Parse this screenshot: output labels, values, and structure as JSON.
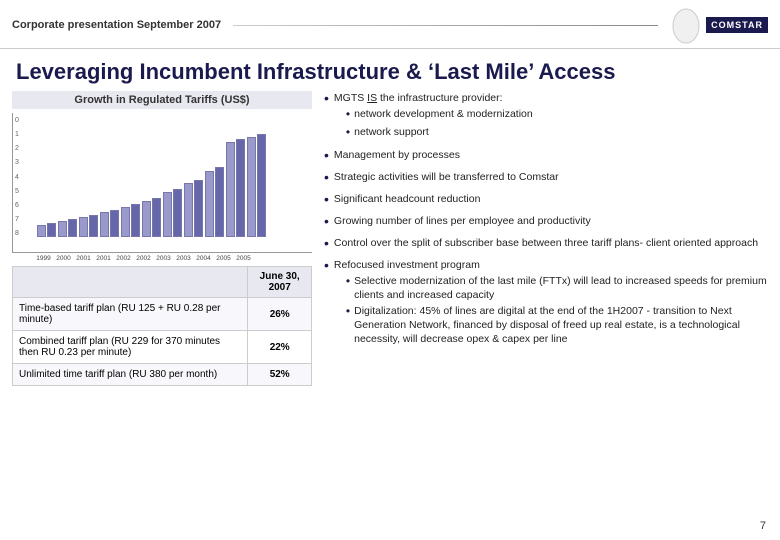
{
  "header": {
    "title_bold": "Corporate presentation",
    "title_normal": " September 2007"
  },
  "page_title": "Leveraging Incumbent Infrastructure & ‘Last Mile’ Access",
  "chart": {
    "title": "Growth in Regulated Tariffs (US$)",
    "y_labels": [
      "8",
      "7",
      "6",
      "5",
      "4",
      "3",
      "2",
      "1",
      "0"
    ],
    "x_labels": [
      "1999",
      "2000",
      "2001",
      "2001",
      "2002",
      "2002",
      "2003",
      "2003",
      "2004",
      "2005",
      "2005"
    ],
    "bars": [
      {
        "h1": 12,
        "h2": 14
      },
      {
        "h1": 16,
        "h2": 17
      },
      {
        "h1": 20,
        "h2": 22
      },
      {
        "h1": 24,
        "h2": 25
      },
      {
        "h1": 28,
        "h2": 30
      },
      {
        "h1": 34,
        "h2": 36
      },
      {
        "h1": 42,
        "h2": 45
      },
      {
        "h1": 50,
        "h2": 53
      },
      {
        "h1": 60,
        "h2": 63
      },
      {
        "h1": 90,
        "h2": 92
      },
      {
        "h1": 94,
        "h2": 96
      }
    ]
  },
  "table": {
    "header_col1": "",
    "header_col2": "June 30, 2007",
    "rows": [
      {
        "plan": "Time-based tariff plan (RU 125 + RU 0.28 per minute)",
        "value": "26%"
      },
      {
        "plan": "Combined tariff plan (RU 229 for 370 minutes then RU 0.23 per minute)",
        "value": "22%"
      },
      {
        "plan": "Unlimited time tariff plan (RU 380 per month)",
        "value": "52%"
      }
    ]
  },
  "bullets": [
    {
      "text": "MGTS ",
      "underline": "IS",
      "text2": " the infrastructure provider:",
      "sub": [
        "network development & modernization",
        "network support"
      ]
    },
    {
      "text": "Management by processes"
    },
    {
      "text": "Strategic activities will be transferred to Comstar"
    },
    {
      "text": "Significant headcount reduction"
    },
    {
      "text": "Growing number of lines per employee and productivity"
    },
    {
      "text": "Control over the split  of subscriber base between three tariff plans- client oriented approach"
    },
    {
      "text": "Refocused investment program",
      "sub": [
        "Selective modernization of the last mile (FTTx) will lead to increased speeds for premium clients and increased capacity",
        "Digitalization: 45% of lines are digital at the end of the 1H2007 - transition to Next Generation Network, financed by disposal of freed up real estate,  is a technological necessity, will decrease opex & capex per line"
      ]
    }
  ],
  "page_number": "7"
}
